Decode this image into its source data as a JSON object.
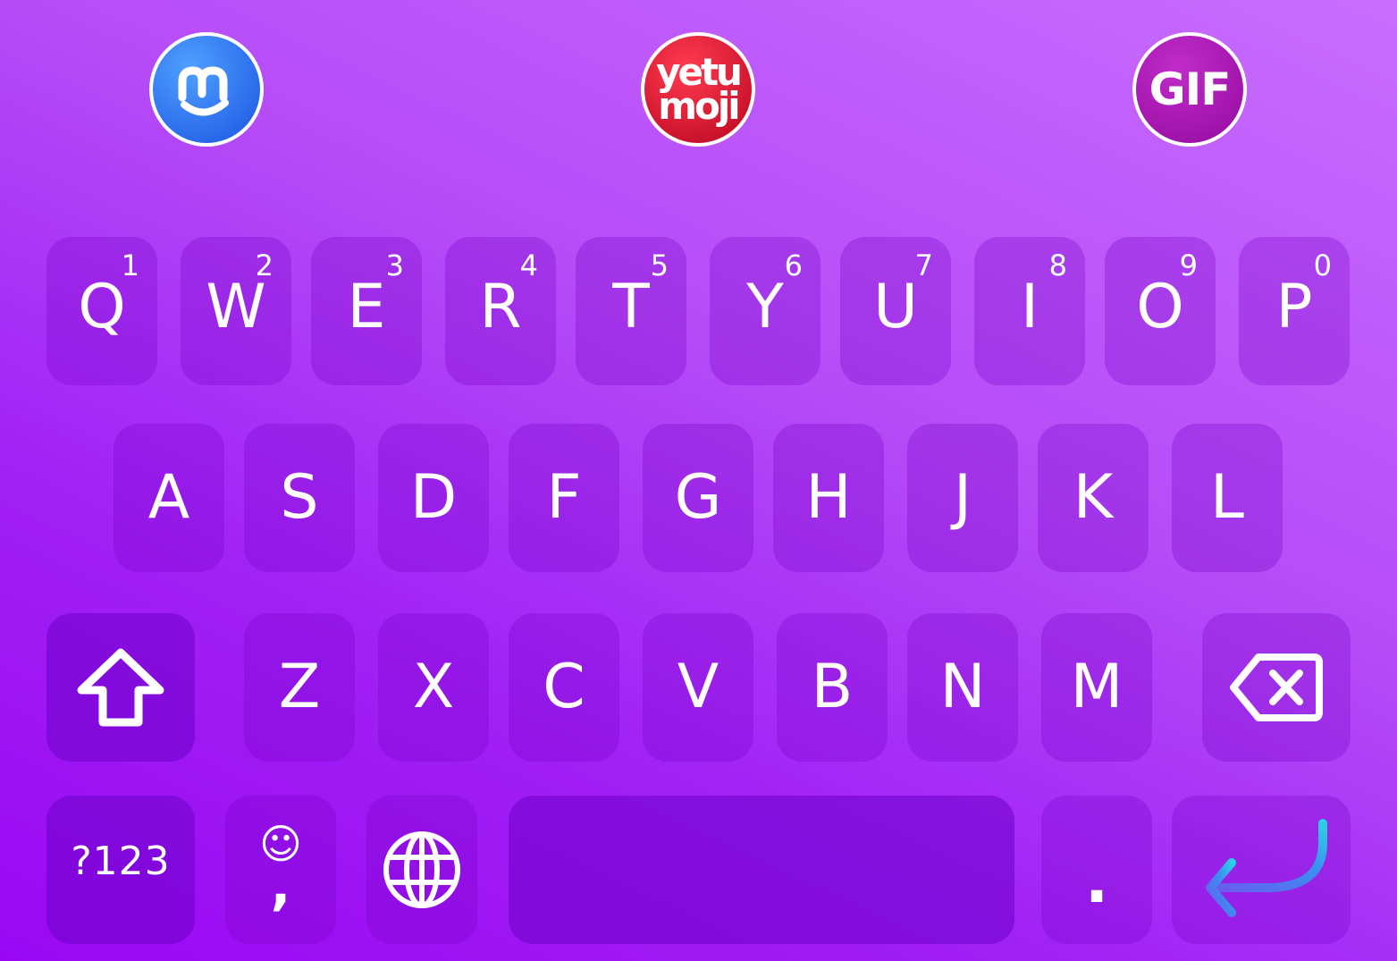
{
  "toolbar": {
    "m_logo": "m-logo-icon",
    "yetu_line1": "yetu",
    "yetu_line2": "moji",
    "gif_label": "GIF"
  },
  "rows": {
    "row1": [
      {
        "label": "Q",
        "sub": "1"
      },
      {
        "label": "W",
        "sub": "2"
      },
      {
        "label": "E",
        "sub": "3"
      },
      {
        "label": "R",
        "sub": "4"
      },
      {
        "label": "T",
        "sub": "5"
      },
      {
        "label": "Y",
        "sub": "6"
      },
      {
        "label": "U",
        "sub": "7"
      },
      {
        "label": "I",
        "sub": "8"
      },
      {
        "label": "O",
        "sub": "9"
      },
      {
        "label": "P",
        "sub": "0"
      }
    ],
    "row2": [
      "A",
      "S",
      "D",
      "F",
      "G",
      "H",
      "J",
      "K",
      "L"
    ],
    "row3": [
      "Z",
      "X",
      "C",
      "V",
      "B",
      "N",
      "M"
    ]
  },
  "bottom": {
    "symbols_label": "?123",
    "emoji_glyph": "☺",
    "comma": ",",
    "period": "."
  },
  "icons": {
    "shift": "shift-icon",
    "backspace": "backspace-icon",
    "globe": "globe-icon",
    "enter": "enter-icon"
  },
  "colors": {
    "background_top": "#c86dff",
    "background_bottom": "#9a08f3",
    "m_button": "#2f78f0",
    "yetu_button": "#d61a33",
    "gif_button": "#b01cba",
    "enter_gradient_start": "#6a5bf0",
    "enter_gradient_end": "#2ad0e8"
  }
}
